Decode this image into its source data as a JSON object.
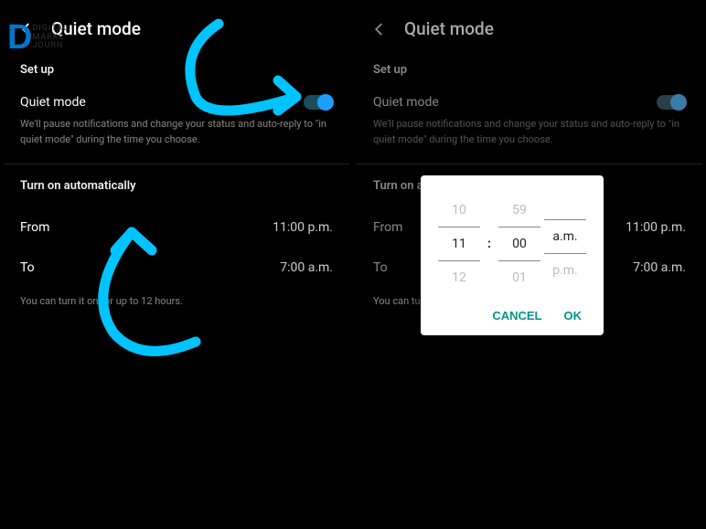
{
  "watermark": {
    "logo": "D",
    "line1": "DIGITAL",
    "line2": "MARKE",
    "line3": "JOURN"
  },
  "screen_left": {
    "title": "Quiet mode",
    "setup_heading": "Set up",
    "quiet_mode_label": "Quiet mode",
    "description": "We'll pause notifications and change your status and auto-reply to \"in quiet mode\" during the time you choose.",
    "auto_heading": "Turn on automatically",
    "from_label": "From",
    "from_value": "11:00 p.m.",
    "to_label": "To",
    "to_value": "7:00 a.m.",
    "hint": "You can turn it on for up to 12 hours."
  },
  "screen_right": {
    "title": "Quiet mode",
    "setup_heading": "Set up",
    "quiet_mode_label": "Quiet mode",
    "description": "We'll pause notifications and change your status and auto-reply to \"in quiet mode\" during the time you choose.",
    "auto_heading": "Turn on a",
    "from_label": "From",
    "from_value": "11:00 p.m.",
    "to_label": "To",
    "to_value": "7:00 a.m.",
    "hint": "You can tur"
  },
  "picker": {
    "hour_prev": "10",
    "hour_sel": "11",
    "hour_next": "12",
    "colon": ":",
    "min_prev": "59",
    "min_sel": "00",
    "min_next": "01",
    "ampm_prev": "",
    "ampm_sel": "a.m.",
    "ampm_next": "p.m.",
    "cancel": "CANCEL",
    "ok": "OK"
  }
}
